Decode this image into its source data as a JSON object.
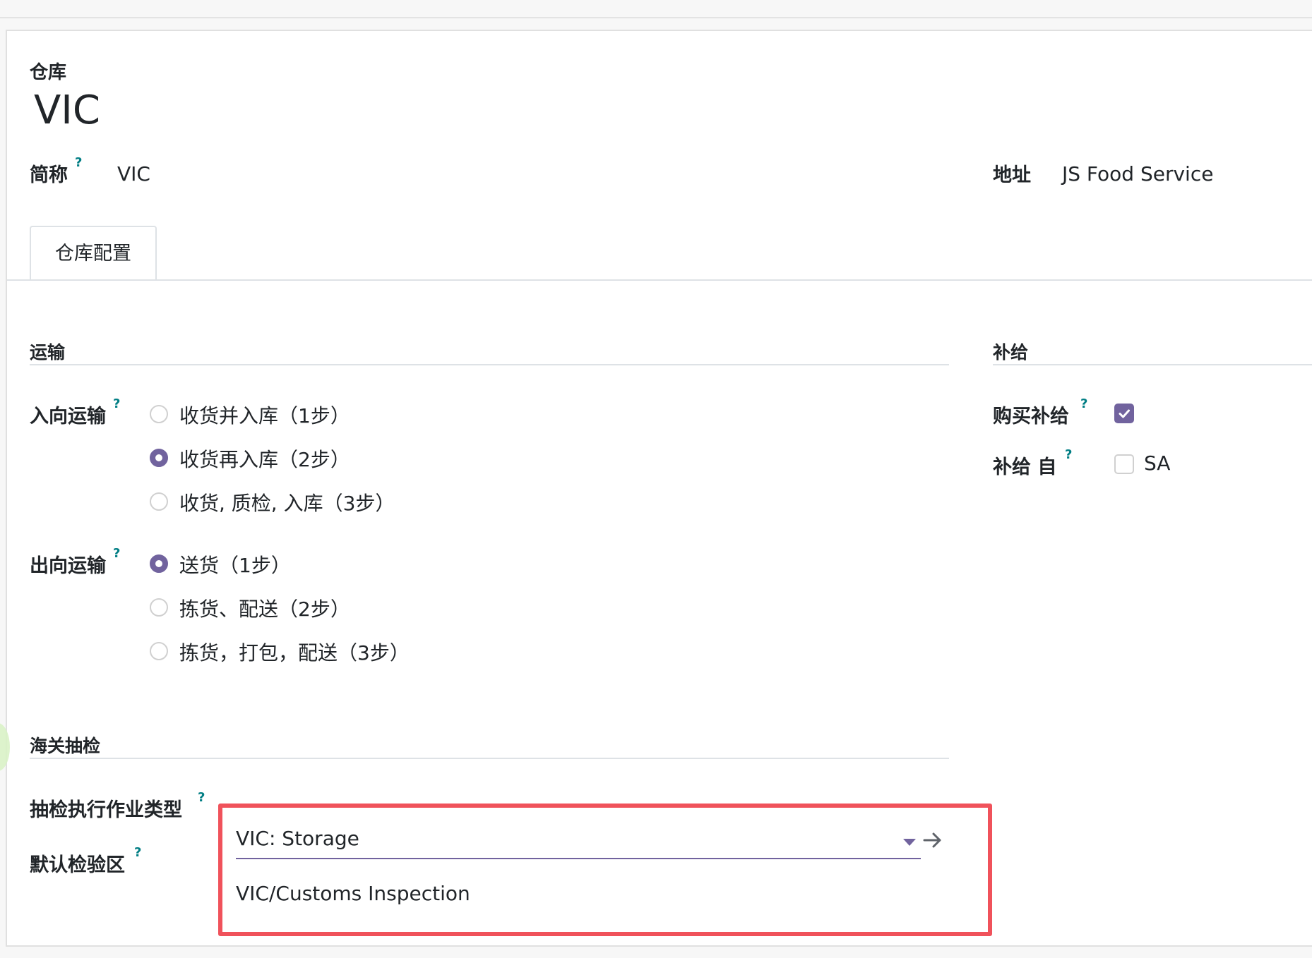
{
  "header": {
    "record_type": "仓库",
    "record_name": "VIC"
  },
  "fields": {
    "short_name_label": "简称",
    "short_name_value": "VIC",
    "address_label": "地址",
    "address_value": "JS Food Service"
  },
  "help_mark": "?",
  "tabs": [
    {
      "label": "仓库配置"
    }
  ],
  "shipping": {
    "title": "运输",
    "incoming": {
      "label": "入向运输",
      "options": [
        {
          "label": "收货并入库（1步）",
          "selected": false
        },
        {
          "label": "收货再入库（2步）",
          "selected": true
        },
        {
          "label": "收货, 质检, 入库（3步）",
          "selected": false
        }
      ]
    },
    "outgoing": {
      "label": "出向运输",
      "options": [
        {
          "label": "送货（1步）",
          "selected": true
        },
        {
          "label": "拣货、配送（2步）",
          "selected": false
        },
        {
          "label": "拣货，打包，配送（3步）",
          "selected": false
        }
      ]
    }
  },
  "replenishment": {
    "title": "补给",
    "buy_label": "购买补给",
    "buy_checked": true,
    "resupply_label": "补给 自",
    "resupply_options": [
      {
        "label": "SA",
        "checked": false
      }
    ]
  },
  "customs": {
    "title": "海关抽检",
    "operation_type_label": "抽检执行作业类型",
    "operation_type_value": "VIC: Storage",
    "default_location_label": "默认检验区",
    "default_location_value": "VIC/Customs Inspection"
  },
  "colors": {
    "accent": "#71639e",
    "help": "#017e84",
    "highlight": "#f0525b"
  },
  "icons": {
    "dropdown": "caret-down-icon",
    "open_record": "arrow-right-icon",
    "checked": "check-icon"
  }
}
